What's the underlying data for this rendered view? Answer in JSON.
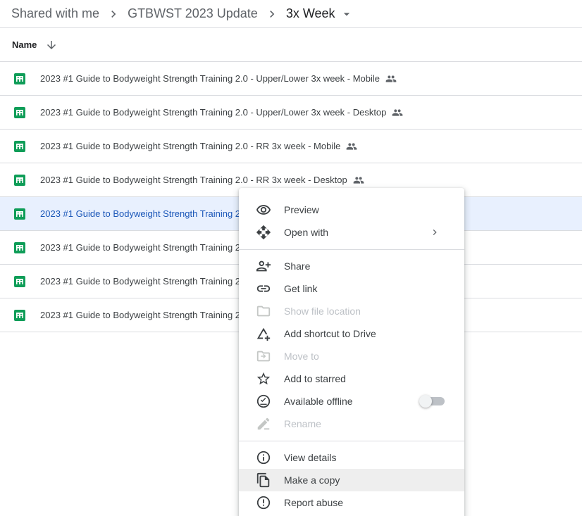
{
  "breadcrumb": {
    "items": [
      "Shared with me",
      "GTBWST 2023 Update",
      "3x Week"
    ]
  },
  "list": {
    "column_name": "Name",
    "rows": [
      {
        "title": "2023 #1 Guide to Bodyweight Strength Training 2.0 - Upper/Lower 3x week - Mobile",
        "shared": true,
        "selected": false
      },
      {
        "title": "2023 #1 Guide to Bodyweight Strength Training 2.0 - Upper/Lower 3x week - Desktop",
        "shared": true,
        "selected": false
      },
      {
        "title": "2023 #1 Guide to Bodyweight Strength Training 2.0 - RR 3x week - Mobile",
        "shared": true,
        "selected": false
      },
      {
        "title": "2023 #1 Guide to Bodyweight Strength Training 2.0 - RR 3x week - Desktop",
        "shared": true,
        "selected": false
      },
      {
        "title": "2023 #1 Guide to Bodyweight Strength Training 2",
        "shared": false,
        "selected": true
      },
      {
        "title": "2023 #1 Guide to Bodyweight Strength Training 2",
        "shared": false,
        "selected": false
      },
      {
        "title": "2023 #1 Guide to Bodyweight Strength Training 2",
        "shared": false,
        "selected": false
      },
      {
        "title": "2023 #1 Guide to Bodyweight Strength Training 2",
        "shared": false,
        "selected": false
      }
    ]
  },
  "context_menu": {
    "groups": [
      [
        {
          "label": "Preview",
          "icon": "eye-icon",
          "disabled": false
        },
        {
          "label": "Open with",
          "icon": "move-arrows-icon",
          "disabled": false,
          "submenu": true
        }
      ],
      [
        {
          "label": "Share",
          "icon": "person-add-icon",
          "disabled": false
        },
        {
          "label": "Get link",
          "icon": "link-icon",
          "disabled": false
        },
        {
          "label": "Show file location",
          "icon": "folder-icon",
          "disabled": true
        },
        {
          "label": "Add shortcut to Drive",
          "icon": "add-shortcut-icon",
          "disabled": false
        },
        {
          "label": "Move to",
          "icon": "move-to-folder-icon",
          "disabled": true
        },
        {
          "label": "Add to starred",
          "icon": "star-icon",
          "disabled": false
        },
        {
          "label": "Available offline",
          "icon": "offline-check-icon",
          "disabled": false,
          "toggle": false
        },
        {
          "label": "Rename",
          "icon": "pencil-icon",
          "disabled": true
        }
      ],
      [
        {
          "label": "View details",
          "icon": "info-icon",
          "disabled": false
        },
        {
          "label": "Make a copy",
          "icon": "copy-icon",
          "disabled": false,
          "hover": true
        },
        {
          "label": "Report abuse",
          "icon": "report-icon",
          "disabled": false
        }
      ]
    ]
  },
  "colors": {
    "sheets_green": "#0f9d58",
    "selected_row": "#e8f0fe",
    "selected_text": "#1a56b8",
    "divider": "#dadce0"
  }
}
